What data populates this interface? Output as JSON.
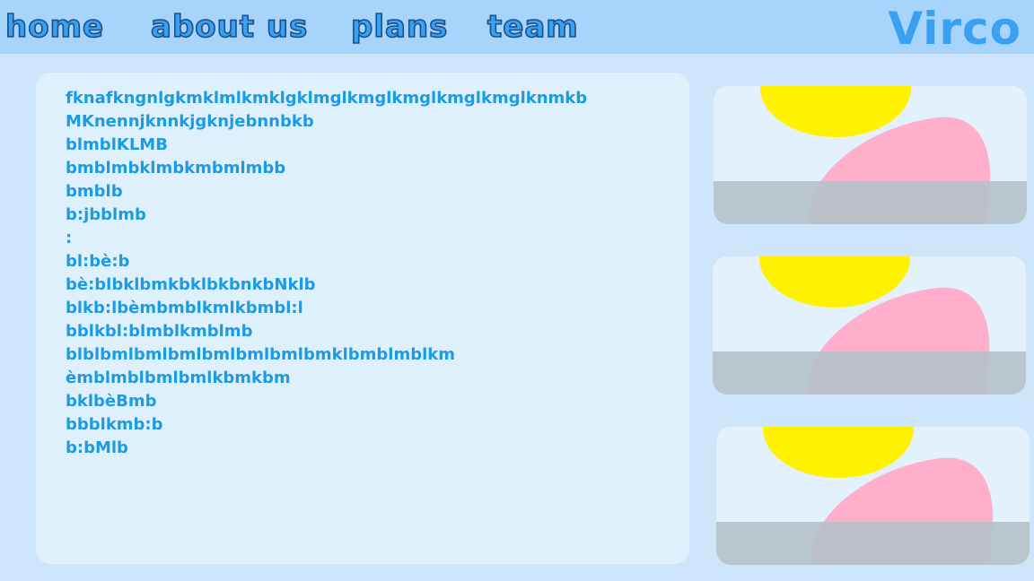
{
  "nav": {
    "items": [
      {
        "label": "home"
      },
      {
        "label": "about us"
      },
      {
        "label": "plans"
      },
      {
        "label": "team"
      }
    ]
  },
  "logo": {
    "text": "Virco"
  },
  "content": {
    "lines": [
      "fknafkngnlgkmklmlkmklgklmglkmglkmglkmglkmglknmkb",
      "MKnennjknnkjgknjebnnbkb",
      "blmblKLMB",
      "bmblmbklmbkmbmlmbb",
      "bmblb",
      "b:jbblmb",
      ":",
      "bl:bè:b",
      "bè:blbklbmkbklbkbnkbNklb",
      "blkb:lbèmbmblkmlkbmbl:l",
      "bblkbl:blmblkmblmb",
      "blblbmlbmlbmlbmlbmlbmlbmklbmblmblkm",
      "èmblmblbmlbmlkbmkbm",
      "bklbèBmb",
      "bbblkmb:b",
      "b:bMlb"
    ]
  },
  "colors": {
    "background": "#cde6fb",
    "topbar": "#a6d4fb",
    "nav_text": "#3aa0f2",
    "panel": "#dff0fd",
    "body_text": "#1b9be6",
    "card_sun": "#fff200",
    "card_shape": "#ffaecb",
    "card_ground": "#b6c2c9"
  },
  "cards": [
    {
      "image": "abstract-illustration"
    },
    {
      "image": "abstract-illustration"
    },
    {
      "image": "abstract-illustration"
    }
  ]
}
